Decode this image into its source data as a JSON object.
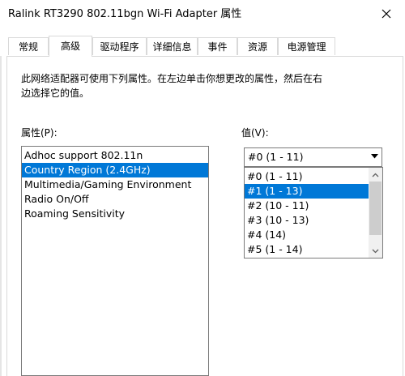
{
  "window": {
    "title": "Ralink RT3290 802.11bgn Wi-Fi Adapter 属性"
  },
  "tabs": [
    {
      "label": "常规",
      "active": false
    },
    {
      "label": "高级",
      "active": true
    },
    {
      "label": "驱动程序",
      "active": false
    },
    {
      "label": "详细信息",
      "active": false
    },
    {
      "label": "事件",
      "active": false
    },
    {
      "label": "资源",
      "active": false
    },
    {
      "label": "电源管理",
      "active": false
    }
  ],
  "advanced": {
    "description_line1": "此网络适配器可使用下列属性。在左边单击你想更改的属性，然后在右",
    "description_line2": "边选择它的值。",
    "property_label": "属性(P):",
    "value_label": "值(V):",
    "properties": [
      {
        "label": "Adhoc support 802.11n",
        "selected": false
      },
      {
        "label": "Country Region (2.4GHz)",
        "selected": true
      },
      {
        "label": "Multimedia/Gaming Environment",
        "selected": false
      },
      {
        "label": "Radio On/Off",
        "selected": false
      },
      {
        "label": "Roaming Sensitivity",
        "selected": false
      }
    ],
    "selected_value": "#0 (1 - 11)",
    "value_options": [
      {
        "label": "#0 (1 - 11)",
        "selected": false
      },
      {
        "label": "#1 (1 - 13)",
        "selected": true
      },
      {
        "label": "#2 (10 - 11)",
        "selected": false
      },
      {
        "label": "#3 (10 - 13)",
        "selected": false
      },
      {
        "label": "#4 (14)",
        "selected": false
      },
      {
        "label": "#5 (1 - 14)",
        "selected": false
      }
    ]
  },
  "colors": {
    "selection": "#0078d7",
    "border": "#7a7a7a",
    "tab_border": "#d9d9d9"
  },
  "icons": {
    "close": "close-icon",
    "dropdown": "dropdown-arrow-icon",
    "scroll_up": "scroll-up-arrow-icon",
    "scroll_down": "scroll-down-arrow-icon"
  }
}
